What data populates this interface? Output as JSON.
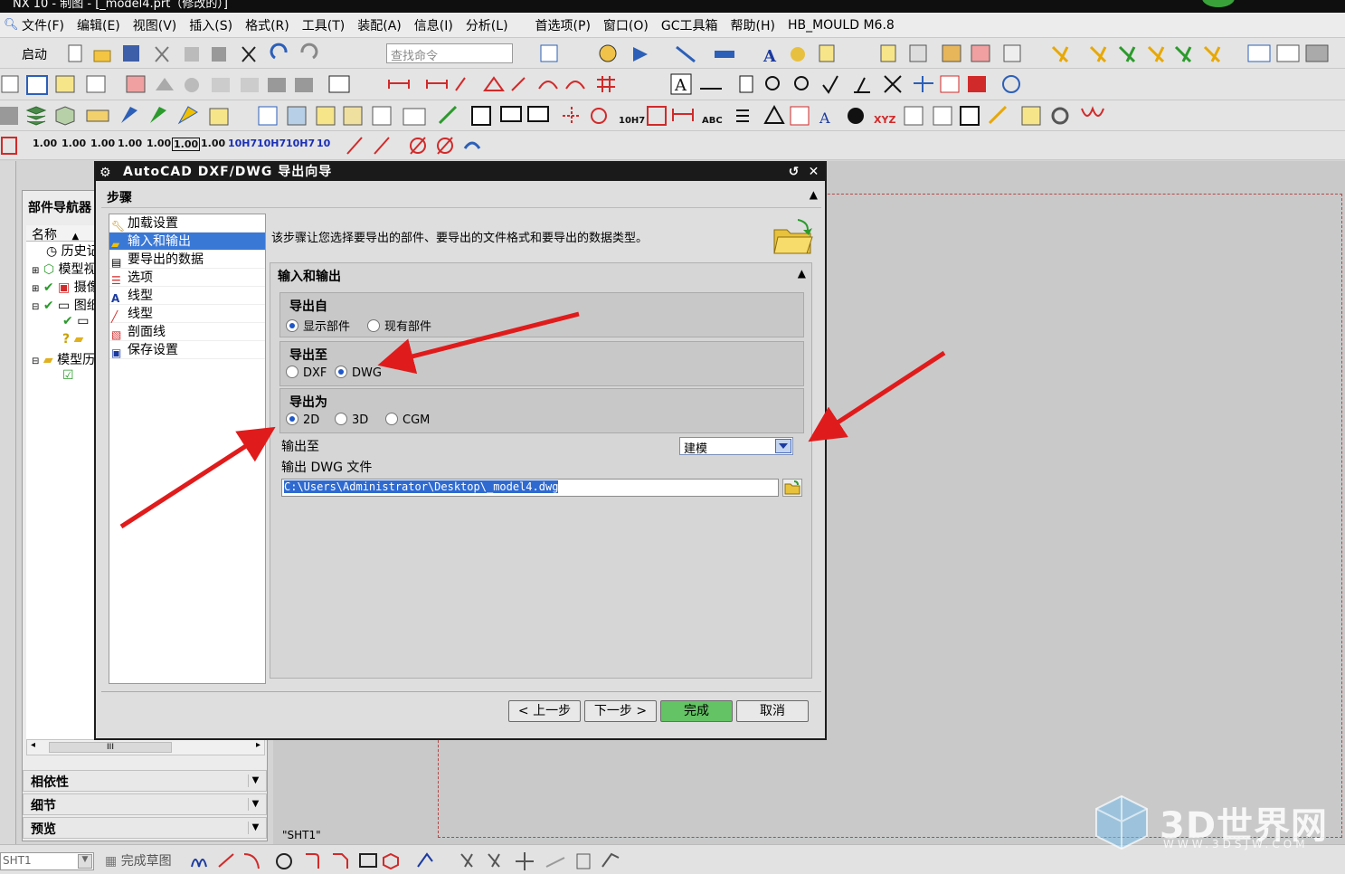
{
  "window": {
    "title": "NX 10 - 制图 - [_model4.prt（修改的）]"
  },
  "menubar": {
    "items": [
      "文件(F)",
      "编辑(E)",
      "视图(V)",
      "插入(S)",
      "格式(R)",
      "工具(T)",
      "装配(A)",
      "信息(I)",
      "分析(L)",
      "首选项(P)",
      "窗口(O)",
      "GC工具箱",
      "帮助(H)",
      "HB_MOULD M6.8"
    ]
  },
  "toolbar": {
    "start_label": "启动",
    "search_placeholder": "查找命令",
    "dimension_values": [
      "1.00",
      "1.00",
      "1.00",
      "1.00",
      "1.00",
      "1.00",
      "1.00",
      "10H7",
      "10H7",
      "10H7",
      "10"
    ]
  },
  "part_navigator": {
    "title": "部件导航器",
    "column_name": "名称",
    "rows": [
      "历史记",
      "模型视",
      "摄像",
      "图纸",
      "",
      "",
      "模型历",
      ""
    ],
    "scroll_label": "III",
    "sections": [
      "相依性",
      "细节",
      "预览"
    ]
  },
  "drawing": {
    "sheet_label": "\"SHT1\""
  },
  "dialog": {
    "title": "AutoCAD DXF/DWG 导出向导",
    "steps_header": "步骤",
    "steps": [
      "加载设置",
      "输入和输出",
      "要导出的数据",
      "选项",
      "线型",
      "线型",
      "剖面线",
      "保存设置"
    ],
    "selected_step": "输入和输出",
    "description": "该步骤让您选择要导出的部件、要导出的文件格式和要导出的数据类型。",
    "panel_title": "输入和输出",
    "export_from": {
      "label": "导出自",
      "options": [
        "显示部件",
        "现有部件"
      ],
      "selected": "显示部件"
    },
    "export_to": {
      "label": "导出至",
      "options": [
        "DXF",
        "DWG"
      ],
      "selected": "DWG"
    },
    "export_as": {
      "label": "导出为",
      "options": [
        "2D",
        "3D",
        "CGM"
      ],
      "selected": "2D"
    },
    "output_to": {
      "label": "输出至",
      "value": "建模"
    },
    "output_file": {
      "label": "输出 DWG 文件",
      "value": "C:\\Users\\Administrator\\Desktop\\_model4.dwg"
    },
    "buttons": {
      "back": "< 上一步",
      "next": "下一步 >",
      "finish": "完成",
      "cancel": "取消"
    }
  },
  "statusbar": {
    "sheet_value": "SHT1",
    "finish_sketch": "完成草图"
  },
  "watermark": {
    "text": "3D世界网",
    "url": "WWW.3DSJW.COM"
  },
  "colors": {
    "selection": "#3a78d6",
    "finish_button": "#64c364",
    "annotation_arrow": "#e01b1b"
  }
}
